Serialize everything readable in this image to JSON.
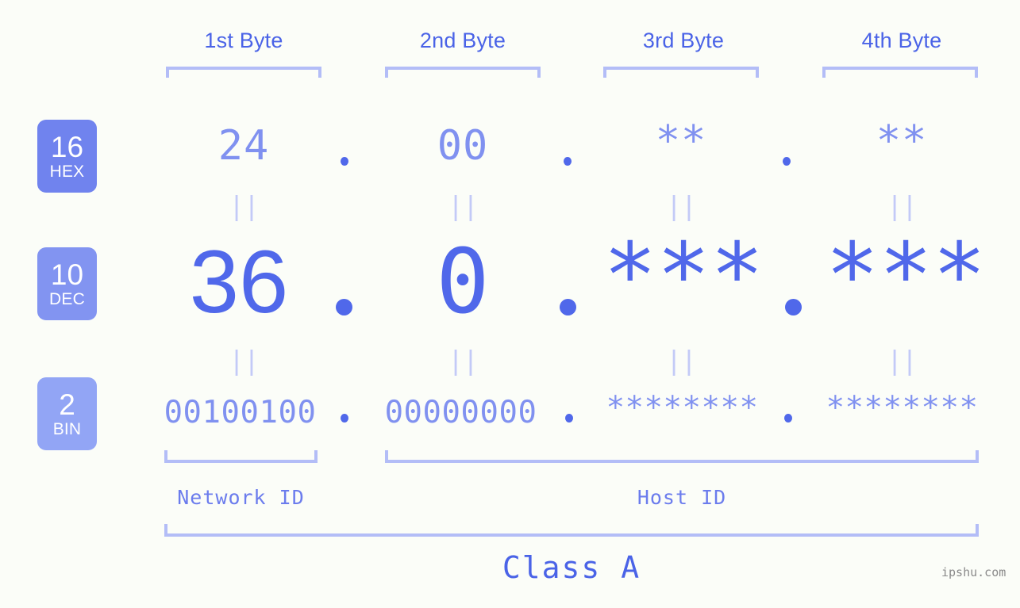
{
  "page": {
    "background_color": "#fbfdf8",
    "accent_color": "#5068ea",
    "light_accent_color": "#8091f0",
    "bracket_color": "#b3bdf7",
    "watermark": "ipshu.com"
  },
  "headers": [
    {
      "label": "1st Byte"
    },
    {
      "label": "2nd Byte"
    },
    {
      "label": "3rd Byte"
    },
    {
      "label": "4th Byte"
    }
  ],
  "bases": [
    {
      "num": "16",
      "label": "HEX",
      "color": "#7083ee"
    },
    {
      "num": "10",
      "label": "DEC",
      "color": "#8294f1"
    },
    {
      "num": "2",
      "label": "BIN",
      "color": "#92a5f5"
    }
  ],
  "rows": {
    "hex": {
      "values": [
        "24",
        "00",
        "**",
        "**"
      ],
      "separator": "."
    },
    "dec": {
      "values": [
        "36",
        "0",
        "***",
        "***"
      ],
      "separator": "."
    },
    "bin": {
      "values": [
        "00100100",
        "00000000",
        "********",
        "********"
      ],
      "separator": "."
    }
  },
  "connectors": {
    "glyph": "||",
    "count_per_gap": 4,
    "gaps": 2
  },
  "footer": {
    "network_id": "Network ID",
    "host_id": "Host ID",
    "class": "Class A"
  }
}
